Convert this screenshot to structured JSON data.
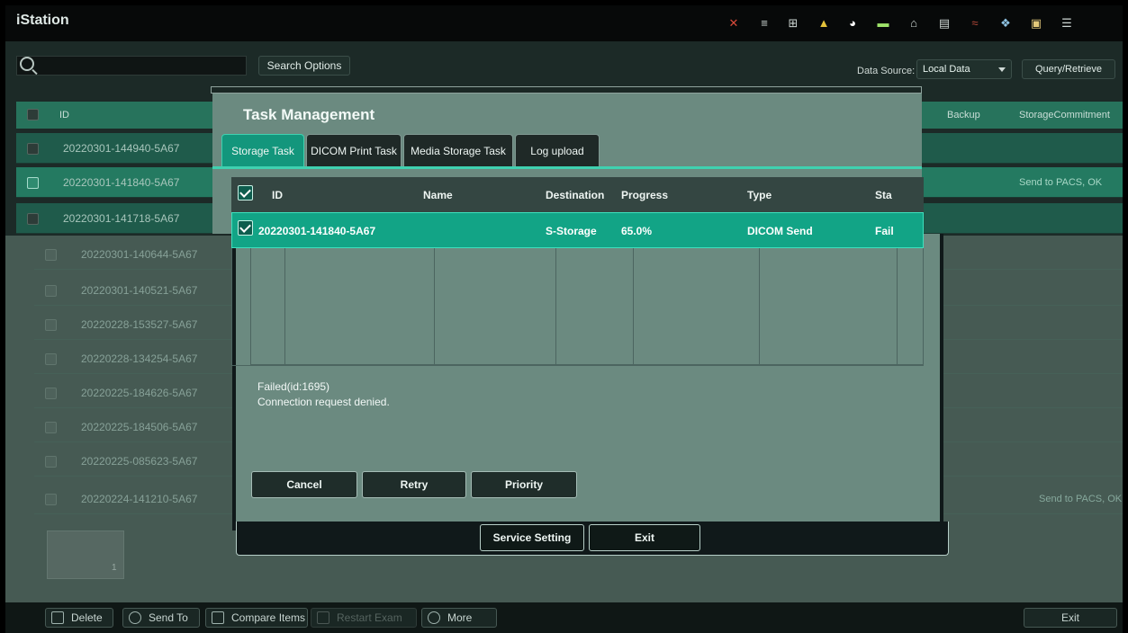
{
  "app": {
    "title": "iStation"
  },
  "status_icons": [
    "x-icon",
    "list-icon",
    "network-icon",
    "warning-icon",
    "pie-icon",
    "battery-icon",
    "mouse-icon",
    "device-icon",
    "wifi-icon",
    "globe-icon",
    "printer-icon",
    "menu-icon"
  ],
  "search": {
    "placeholder": "",
    "options_label": "Search Options"
  },
  "data_source": {
    "label": "Data Source:",
    "value": "Local Data",
    "query_label": "Query/Retrieve"
  },
  "list": {
    "headers": {
      "id": "ID",
      "backup": "Backup",
      "storage": "StorageCommitment"
    },
    "rows": [
      {
        "id": "20220301-144940-5A67",
        "checked": false,
        "status": ""
      },
      {
        "id": "20220301-141840-5A67",
        "checked": true,
        "status": "Send to PACS, OK"
      },
      {
        "id": "20220301-141718-5A67",
        "checked": false,
        "status": ""
      },
      {
        "id": "20220301-140644-5A67",
        "checked": false,
        "status": ""
      },
      {
        "id": "20220301-140521-5A67",
        "checked": false,
        "status": ""
      },
      {
        "id": "20220228-153527-5A67",
        "checked": false,
        "status": ""
      },
      {
        "id": "20220228-134254-5A67",
        "checked": false,
        "status": ""
      },
      {
        "id": "20220225-184626-5A67",
        "checked": false,
        "status": ""
      },
      {
        "id": "20220225-184506-5A67",
        "checked": false,
        "status": ""
      },
      {
        "id": "20220225-085623-5A67",
        "checked": false,
        "status": ""
      },
      {
        "id": "20220224-141210-5A67",
        "checked": false,
        "status": "Send to PACS, OK"
      }
    ]
  },
  "thumbnail": {
    "count": "1"
  },
  "toolbar": {
    "delete": "Delete",
    "send_to": "Send To",
    "compare": "Compare Items",
    "restart": "Restart Exam",
    "more": "More",
    "exit": "Exit"
  },
  "dialog": {
    "title": "Task Management",
    "tabs": [
      "Storage Task",
      "DICOM Print Task",
      "Media Storage Task",
      "Log upload"
    ],
    "columns": [
      "ID",
      "Name",
      "Destination",
      "Progress",
      "Type",
      "Sta"
    ],
    "task": {
      "id": "20220301-141840-5A67",
      "name": "",
      "destination": "S-Storage",
      "progress": "65.0%",
      "type": "DICOM Send",
      "status": "Fail"
    },
    "error_code": "Failed(id:1695)",
    "error_message": "Connection request denied.",
    "buttons": {
      "cancel": "Cancel",
      "retry": "Retry",
      "priority": "Priority"
    },
    "footer": {
      "service": "Service Setting",
      "exit": "Exit"
    }
  },
  "colors": {
    "accent": "#13967c",
    "header": "#27735c",
    "dialog_bg": "#6b8a80"
  }
}
